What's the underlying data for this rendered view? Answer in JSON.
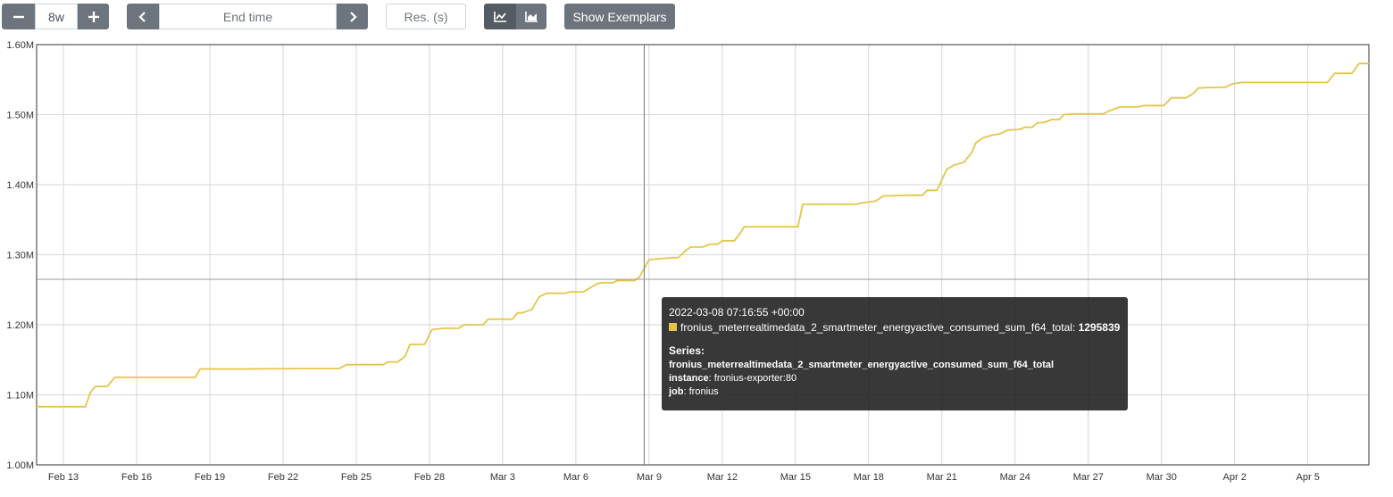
{
  "toolbar": {
    "range_value": "8w",
    "end_time_placeholder": "End time",
    "resolution_placeholder": "Res. (s)",
    "show_exemplars_label": "Show Exemplars"
  },
  "colors": {
    "series": "#e4c54a",
    "tooltip_bg": "#1c1c1c",
    "button": "#6c757d"
  },
  "icons": {
    "decrease": "minus-icon",
    "increase": "plus-icon",
    "back": "chevron-left-icon",
    "forward": "chevron-right-icon",
    "unstacked": "line-chart-icon",
    "stacked": "area-chart-icon"
  },
  "tooltip": {
    "timestamp": "2022-03-08 07:16:55 +00:00",
    "metric_name": "fronius_meterrealtimedata_2_smartmeter_energyactive_consumed_sum_f64_total",
    "metric_suffix": ": ",
    "value": "1295839",
    "series_heading": "Series:",
    "series_name": "fronius_meterrealtimedata_2_smartmeter_energyactive_consumed_sum_f64_total",
    "labels": [
      {
        "key": "instance",
        "sep": ": ",
        "value": "fronius-exporter:80"
      },
      {
        "key": "job",
        "sep": ": ",
        "value": "fronius"
      }
    ]
  },
  "chart_data": {
    "type": "line",
    "ylim": [
      1000000,
      1600000
    ],
    "y_ticks": [
      {
        "value": 1000000,
        "label": "1.00M"
      },
      {
        "value": 1100000,
        "label": "1.10M"
      },
      {
        "value": 1200000,
        "label": "1.20M"
      },
      {
        "value": 1300000,
        "label": "1.30M"
      },
      {
        "value": 1400000,
        "label": "1.40M"
      },
      {
        "value": 1500000,
        "label": "1.50M"
      },
      {
        "value": 1600000,
        "label": "1.60M"
      }
    ],
    "x_ticks": [
      {
        "day": 13,
        "label": "Feb 13"
      },
      {
        "day": 16,
        "label": "Feb 16"
      },
      {
        "day": 19,
        "label": "Feb 19"
      },
      {
        "day": 22,
        "label": "Feb 22"
      },
      {
        "day": 25,
        "label": "Feb 25"
      },
      {
        "day": 28,
        "label": "Feb 28"
      },
      {
        "day": 31,
        "label": "Mar 3"
      },
      {
        "day": 34,
        "label": "Mar 6"
      },
      {
        "day": 37,
        "label": "Mar 9"
      },
      {
        "day": 40,
        "label": "Mar 12"
      },
      {
        "day": 43,
        "label": "Mar 15"
      },
      {
        "day": 46,
        "label": "Mar 18"
      },
      {
        "day": 49,
        "label": "Mar 21"
      },
      {
        "day": 52,
        "label": "Mar 24"
      },
      {
        "day": 55,
        "label": "Mar 27"
      },
      {
        "day": 58,
        "label": "Mar 30"
      },
      {
        "day": 61,
        "label": "Apr 2"
      },
      {
        "day": 64,
        "label": "Apr 5"
      }
    ],
    "xlim": [
      11.9,
      66.5
    ],
    "grid": true,
    "hover_x": 36.8,
    "hover_y": 1295839,
    "series": [
      {
        "name": "fronius_meterrealtimedata_2_smartmeter_energyactive_consumed_sum_f64_total",
        "points": [
          [
            11.9,
            1083000
          ],
          [
            13.9,
            1083000
          ],
          [
            14.1,
            1103000
          ],
          [
            14.3,
            1112000
          ],
          [
            14.8,
            1112000
          ],
          [
            15.1,
            1125000
          ],
          [
            18.4,
            1125000
          ],
          [
            18.6,
            1137000
          ],
          [
            20.5,
            1137000
          ],
          [
            22.5,
            1137500
          ],
          [
            24.3,
            1137500
          ],
          [
            24.6,
            1143000
          ],
          [
            26.1,
            1143000
          ],
          [
            26.3,
            1147000
          ],
          [
            26.7,
            1147000
          ],
          [
            27.0,
            1155000
          ],
          [
            27.2,
            1172000
          ],
          [
            27.8,
            1172000
          ],
          [
            28.1,
            1193000
          ],
          [
            28.6,
            1195000
          ],
          [
            29.2,
            1195000
          ],
          [
            29.4,
            1200000
          ],
          [
            30.2,
            1200000
          ],
          [
            30.4,
            1208000
          ],
          [
            31.4,
            1208000
          ],
          [
            31.6,
            1217000
          ],
          [
            31.8,
            1217000
          ],
          [
            32.2,
            1222000
          ],
          [
            32.5,
            1240000
          ],
          [
            32.8,
            1245000
          ],
          [
            33.5,
            1245000
          ],
          [
            33.8,
            1247000
          ],
          [
            34.3,
            1247000
          ],
          [
            34.6,
            1253000
          ],
          [
            34.9,
            1259000
          ],
          [
            35.1,
            1260000
          ],
          [
            35.5,
            1260000
          ],
          [
            35.7,
            1263000
          ],
          [
            36.4,
            1263000
          ],
          [
            36.6,
            1268000
          ],
          [
            37.0,
            1293000
          ],
          [
            37.7,
            1295000
          ],
          [
            38.2,
            1296000
          ],
          [
            38.5,
            1306000
          ],
          [
            38.7,
            1311000
          ],
          [
            39.2,
            1311000
          ],
          [
            39.5,
            1315000
          ],
          [
            39.8,
            1315000
          ],
          [
            40.0,
            1320000
          ],
          [
            40.5,
            1320000
          ],
          [
            40.7,
            1329000
          ],
          [
            40.9,
            1340000
          ],
          [
            43.1,
            1340000
          ],
          [
            43.3,
            1372000
          ],
          [
            44.6,
            1372000
          ],
          [
            45.5,
            1372000
          ],
          [
            45.7,
            1374000
          ],
          [
            46.0,
            1375000
          ],
          [
            46.3,
            1377000
          ],
          [
            46.6,
            1384000
          ],
          [
            47.7,
            1385000
          ],
          [
            48.2,
            1385000
          ],
          [
            48.4,
            1392000
          ],
          [
            48.8,
            1392000
          ],
          [
            49.2,
            1422000
          ],
          [
            49.5,
            1428000
          ],
          [
            49.9,
            1432000
          ],
          [
            50.2,
            1445000
          ],
          [
            50.4,
            1460000
          ],
          [
            50.7,
            1467000
          ],
          [
            51.1,
            1471000
          ],
          [
            51.4,
            1473000
          ],
          [
            51.7,
            1478000
          ],
          [
            52.2,
            1479000
          ],
          [
            52.4,
            1482000
          ],
          [
            52.7,
            1482000
          ],
          [
            52.9,
            1488000
          ],
          [
            53.2,
            1489000
          ],
          [
            53.5,
            1493000
          ],
          [
            53.8,
            1493000
          ],
          [
            54.0,
            1500000
          ],
          [
            54.4,
            1501000
          ],
          [
            55.6,
            1501000
          ],
          [
            55.9,
            1506000
          ],
          [
            56.3,
            1511000
          ],
          [
            57.0,
            1511000
          ],
          [
            57.3,
            1513000
          ],
          [
            58.1,
            1513000
          ],
          [
            58.4,
            1524000
          ],
          [
            59.0,
            1524000
          ],
          [
            59.3,
            1530000
          ],
          [
            59.5,
            1538000
          ],
          [
            60.2,
            1539000
          ],
          [
            60.6,
            1539000
          ],
          [
            60.9,
            1544000
          ],
          [
            61.3,
            1546000
          ],
          [
            64.8,
            1546000
          ],
          [
            65.1,
            1559000
          ],
          [
            65.8,
            1559000
          ],
          [
            66.1,
            1573000
          ],
          [
            66.5,
            1573000
          ],
          [
            73.0,
            1573000
          ]
        ]
      }
    ]
  }
}
